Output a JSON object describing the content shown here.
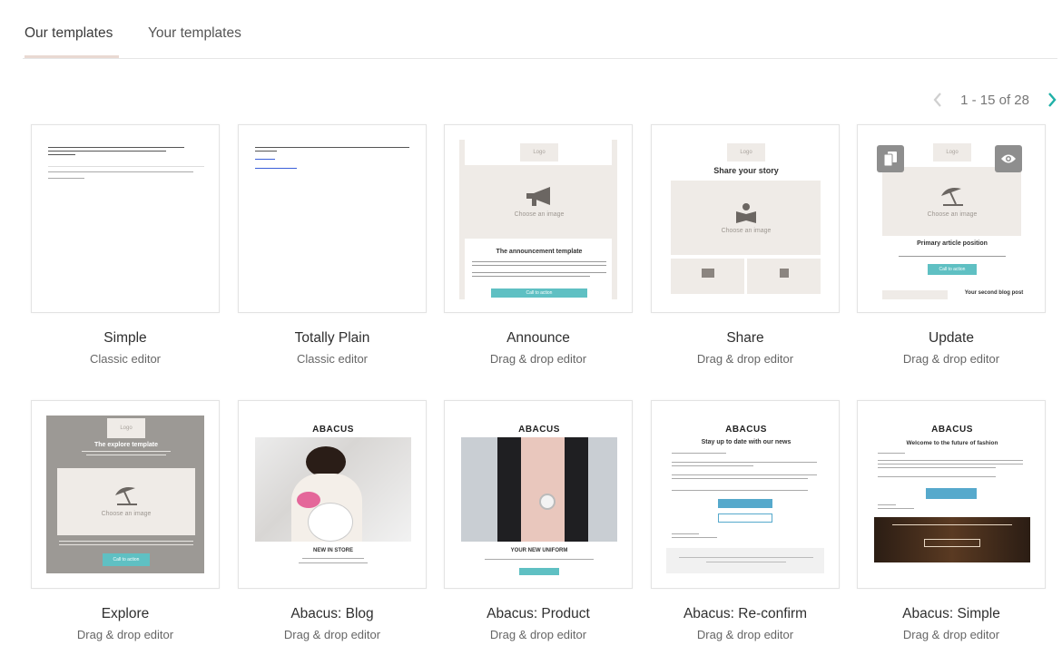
{
  "tabs": [
    {
      "label": "Our templates",
      "active": true
    },
    {
      "label": "Your templates",
      "active": false
    }
  ],
  "pagination": {
    "text": "1 - 15 of 28",
    "prev_icon": "chevron-left-icon",
    "next_icon": "chevron-right-icon",
    "accent": "#1fb0a7"
  },
  "templates": [
    {
      "name": "Simple",
      "editor": "Classic editor"
    },
    {
      "name": "Totally Plain",
      "editor": "Classic editor"
    },
    {
      "name": "Announce",
      "editor": "Drag & drop editor"
    },
    {
      "name": "Share",
      "editor": "Drag & drop editor"
    },
    {
      "name": "Update",
      "editor": "Drag & drop editor"
    },
    {
      "name": "Explore",
      "editor": "Drag & drop editor"
    },
    {
      "name": "Abacus: Blog",
      "editor": "Drag & drop editor"
    },
    {
      "name": "Abacus: Product",
      "editor": "Drag & drop editor"
    },
    {
      "name": "Abacus: Re-confirm",
      "editor": "Drag & drop editor"
    },
    {
      "name": "Abacus: Simple",
      "editor": "Drag & drop editor"
    }
  ],
  "thumbs": {
    "logo": "Logo",
    "choose_image": "Choose an image",
    "announce_title": "The announcement template",
    "share_title": "Share your story",
    "update_title": "Primary article position",
    "update_second": "Your second blog post",
    "explore_title": "The explore template",
    "abacus": "ABACUS",
    "blog_caption": "NEW IN STORE",
    "product_caption": "YOUR NEW UNIFORM",
    "reconfirm_title": "Stay up to date with our news",
    "simple_title": "Welcome to the future of fashion",
    "cta": "Call to action"
  }
}
